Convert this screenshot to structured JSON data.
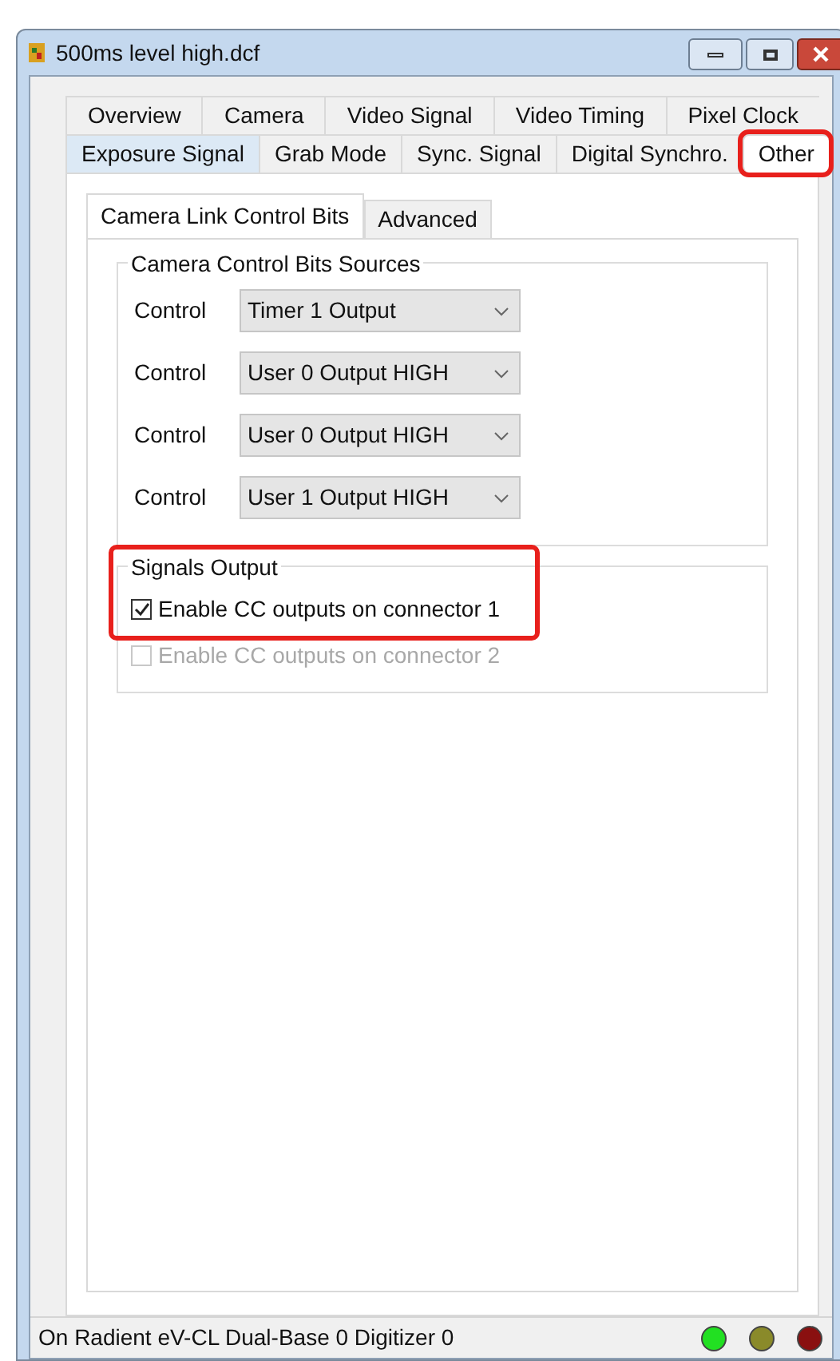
{
  "window": {
    "title": "500ms level high.dcf"
  },
  "tab_rows": [
    [
      {
        "label": "Overview",
        "selected": false
      },
      {
        "label": "Camera",
        "selected": false
      },
      {
        "label": "Video Signal",
        "selected": false
      },
      {
        "label": "Video Timing",
        "selected": false
      },
      {
        "label": "Pixel Clock",
        "selected": false
      }
    ],
    [
      {
        "label": "Exposure Signal",
        "selected": false
      },
      {
        "label": "Grab Mode",
        "selected": false
      },
      {
        "label": "Sync. Signal",
        "selected": false
      },
      {
        "label": "Digital Synchro.",
        "selected": false
      },
      {
        "label": "Other",
        "selected": true,
        "highlighted": true
      }
    ]
  ],
  "subtabs": [
    {
      "label": "Camera Link Control Bits",
      "selected": true
    },
    {
      "label": "Advanced",
      "selected": false
    }
  ],
  "sources_group": {
    "title": "Camera Control Bits Sources",
    "rows": [
      {
        "label": "Control",
        "value": "Timer 1 Output"
      },
      {
        "label": "Control",
        "value": "User 0 Output HIGH"
      },
      {
        "label": "Control",
        "value": "User 0 Output HIGH"
      },
      {
        "label": "Control",
        "value": "User 1 Output HIGH"
      }
    ]
  },
  "output_group": {
    "title": "Signals Output",
    "highlighted": true,
    "checkboxes": [
      {
        "label": "Enable CC outputs on connector 1",
        "checked": true,
        "disabled": false
      },
      {
        "label": "Enable CC outputs on connector 2",
        "checked": false,
        "disabled": true
      }
    ]
  },
  "status_bar": {
    "text": "On Radient eV-CL Dual-Base 0 Digitizer 0",
    "lights": [
      {
        "color": "#22e022"
      },
      {
        "color": "#8a8a2a"
      },
      {
        "color": "#8a1010"
      }
    ]
  }
}
